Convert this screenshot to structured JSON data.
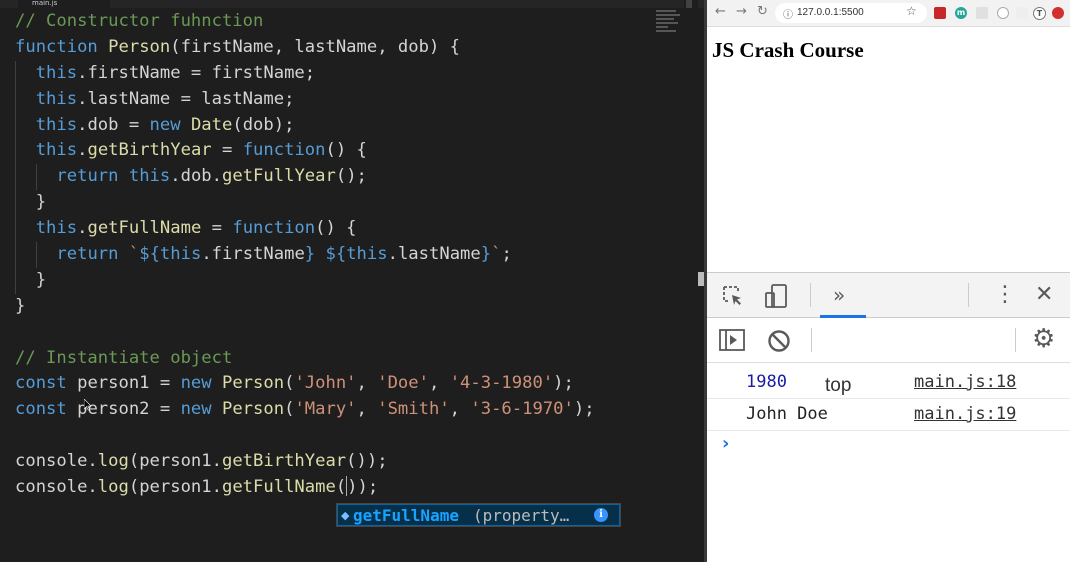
{
  "editor": {
    "tab_title": "main.js",
    "lines": [
      [
        {
          "c": "cm",
          "t": "// Constructor fuhnction"
        }
      ],
      [
        {
          "c": "kw",
          "t": "function"
        },
        {
          "c": "",
          "t": " "
        },
        {
          "c": "fn",
          "t": "Person"
        },
        {
          "c": "",
          "t": "(firstName, lastName, dob) {"
        }
      ],
      [
        {
          "c": "",
          "t": "  "
        },
        {
          "c": "kw",
          "t": "this"
        },
        {
          "c": "",
          "t": ".firstName = firstName;"
        }
      ],
      [
        {
          "c": "",
          "t": "  "
        },
        {
          "c": "kw",
          "t": "this"
        },
        {
          "c": "",
          "t": ".lastName = lastName;"
        }
      ],
      [
        {
          "c": "",
          "t": "  "
        },
        {
          "c": "kw",
          "t": "this"
        },
        {
          "c": "",
          "t": ".dob = "
        },
        {
          "c": "kw",
          "t": "new"
        },
        {
          "c": "",
          "t": " "
        },
        {
          "c": "fn",
          "t": "Date"
        },
        {
          "c": "",
          "t": "(dob);"
        }
      ],
      [
        {
          "c": "",
          "t": "  "
        },
        {
          "c": "kw",
          "t": "this"
        },
        {
          "c": "",
          "t": "."
        },
        {
          "c": "fn",
          "t": "getBirthYear"
        },
        {
          "c": "",
          "t": " = "
        },
        {
          "c": "kw",
          "t": "function"
        },
        {
          "c": "",
          "t": "() {"
        }
      ],
      [
        {
          "c": "",
          "t": "    "
        },
        {
          "c": "kw",
          "t": "return"
        },
        {
          "c": "",
          "t": " "
        },
        {
          "c": "kw",
          "t": "this"
        },
        {
          "c": "",
          "t": ".dob."
        },
        {
          "c": "fn",
          "t": "getFullYear"
        },
        {
          "c": "",
          "t": "();"
        }
      ],
      [
        {
          "c": "",
          "t": "  }"
        }
      ],
      [
        {
          "c": "",
          "t": "  "
        },
        {
          "c": "kw",
          "t": "this"
        },
        {
          "c": "",
          "t": "."
        },
        {
          "c": "fn",
          "t": "getFullName"
        },
        {
          "c": "",
          "t": " = "
        },
        {
          "c": "kw",
          "t": "function"
        },
        {
          "c": "",
          "t": "() {"
        }
      ],
      [
        {
          "c": "",
          "t": "    "
        },
        {
          "c": "kw",
          "t": "return"
        },
        {
          "c": "",
          "t": " "
        },
        {
          "c": "st",
          "t": "`"
        },
        {
          "c": "kw",
          "t": "${this"
        },
        {
          "c": "",
          "t": ".firstName"
        },
        {
          "c": "kw",
          "t": "}"
        },
        {
          "c": "st",
          "t": " "
        },
        {
          "c": "kw",
          "t": "${this"
        },
        {
          "c": "",
          "t": ".lastName"
        },
        {
          "c": "kw",
          "t": "}"
        },
        {
          "c": "st",
          "t": "`"
        },
        {
          "c": "",
          "t": ";"
        }
      ],
      [
        {
          "c": "",
          "t": "  }"
        }
      ],
      [
        {
          "c": "",
          "t": "}"
        }
      ],
      [],
      [
        {
          "c": "cm",
          "t": "// Instantiate object"
        }
      ],
      [
        {
          "c": "kw",
          "t": "const"
        },
        {
          "c": "",
          "t": " person1 = "
        },
        {
          "c": "kw",
          "t": "new"
        },
        {
          "c": "",
          "t": " "
        },
        {
          "c": "fn",
          "t": "Person"
        },
        {
          "c": "",
          "t": "("
        },
        {
          "c": "st",
          "t": "'John'"
        },
        {
          "c": "",
          "t": ", "
        },
        {
          "c": "st",
          "t": "'Doe'"
        },
        {
          "c": "",
          "t": ", "
        },
        {
          "c": "st",
          "t": "'4-3-1980'"
        },
        {
          "c": "",
          "t": ");"
        }
      ],
      [
        {
          "c": "kw",
          "t": "const"
        },
        {
          "c": "",
          "t": " person2 = "
        },
        {
          "c": "kw",
          "t": "new"
        },
        {
          "c": "",
          "t": " "
        },
        {
          "c": "fn",
          "t": "Person"
        },
        {
          "c": "",
          "t": "("
        },
        {
          "c": "st",
          "t": "'Mary'"
        },
        {
          "c": "",
          "t": ", "
        },
        {
          "c": "st",
          "t": "'Smith'"
        },
        {
          "c": "",
          "t": ", "
        },
        {
          "c": "st",
          "t": "'3-6-1970'"
        },
        {
          "c": "",
          "t": ");"
        }
      ],
      [],
      [
        {
          "c": "",
          "t": "console."
        },
        {
          "c": "fn",
          "t": "log"
        },
        {
          "c": "",
          "t": "(person1."
        },
        {
          "c": "fn",
          "t": "getBirthYear"
        },
        {
          "c": "",
          "t": "());"
        }
      ],
      [
        {
          "c": "",
          "t": "console."
        },
        {
          "c": "fn",
          "t": "log"
        },
        {
          "c": "",
          "t": "(person1."
        },
        {
          "c": "fn",
          "t": "getFullName"
        },
        {
          "c": "",
          "t": "("
        },
        {
          "c": "caret",
          "t": ""
        },
        {
          "c": "",
          "t": "));"
        }
      ]
    ],
    "suggestion": {
      "label": "getFullName",
      "detail": "(property…",
      "info_icon": "i"
    }
  },
  "browser": {
    "url": "127.0.0.1:5500",
    "page_heading": "JS Crash Course",
    "extension_letters": [
      "m",
      "T"
    ]
  },
  "devtools": {
    "context": "top",
    "logs": [
      {
        "message": "1980",
        "color": "#1a1aa6",
        "source": "main.js:18"
      },
      {
        "message": "John Doe",
        "color": "#222222",
        "source": "main.js:19"
      }
    ],
    "prompt_symbol": "›"
  }
}
